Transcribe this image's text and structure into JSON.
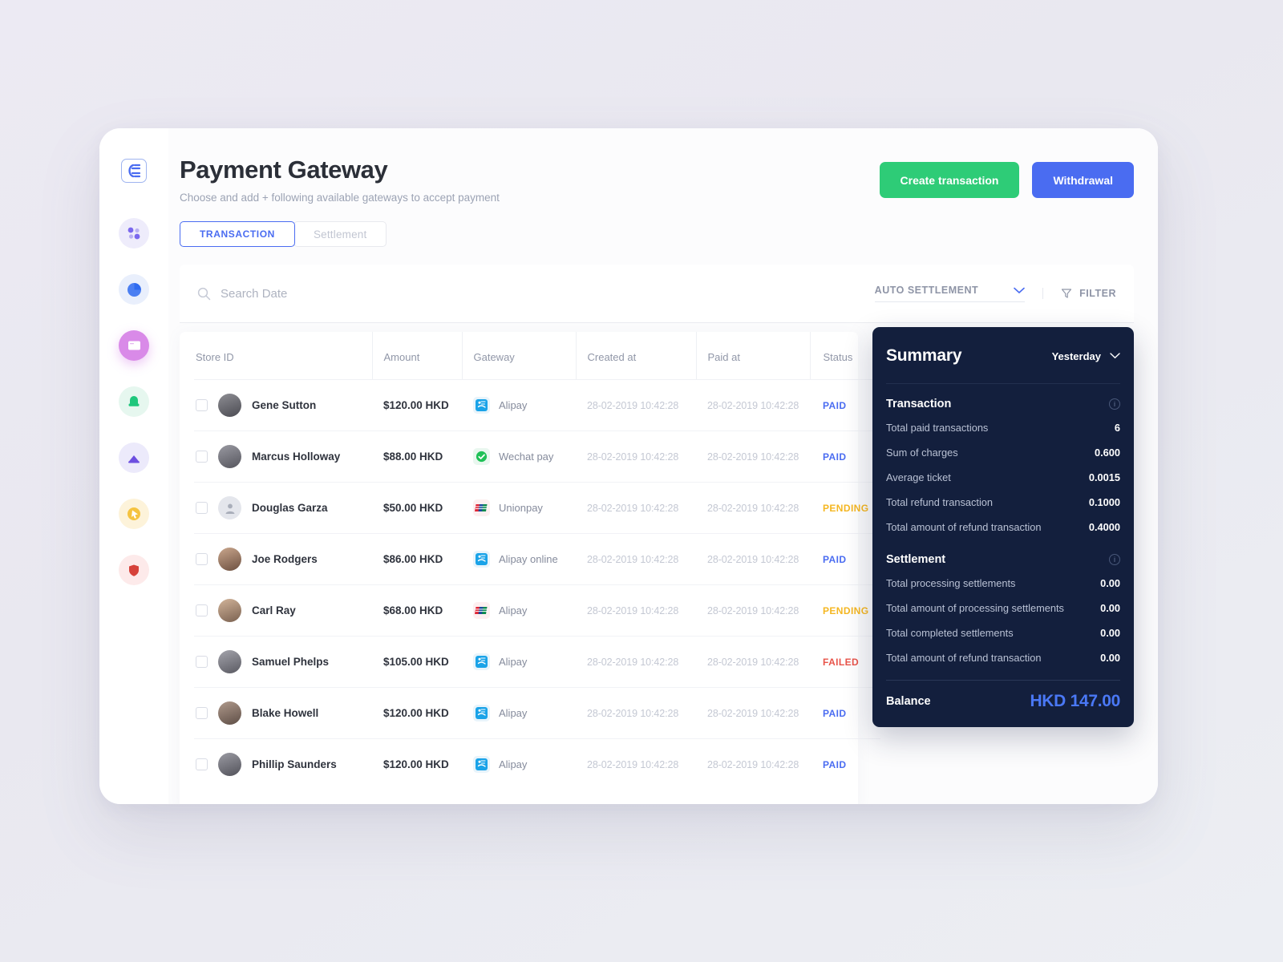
{
  "sidebar": {
    "logo_name": "logo-badge",
    "items": [
      {
        "name": "analytics-dots-icon",
        "color": "#7b68ee"
      },
      {
        "name": "pie-chart-icon",
        "color": "#2f6bf0"
      },
      {
        "name": "payments-card-icon",
        "color": "#ffffff"
      },
      {
        "name": "messages-icon",
        "color": "#1fc77c"
      },
      {
        "name": "media-upload-icon",
        "color": "#6d4fe0"
      },
      {
        "name": "cursor-click-icon",
        "color": "#f0ab1d"
      },
      {
        "name": "shield-icon",
        "color": "#d6413a"
      }
    ]
  },
  "header": {
    "title": "Payment Gateway",
    "subtitle": "Choose and add + following available gateways to accept payment",
    "create_label": "Create transaction",
    "withdrawal_label": "Withdrawal",
    "create_color": "#2ecc77",
    "withdrawal_color": "#4a6cf1"
  },
  "tabs": [
    {
      "label": "TRANSACTION",
      "active": true
    },
    {
      "label": "Settlement",
      "active": false
    }
  ],
  "search": {
    "placeholder": "Search Date",
    "value": "",
    "settlement_select": "AUTO SETTLEMENT",
    "filter_label": "FILTER"
  },
  "table": {
    "columns": [
      "Store ID",
      "Amount",
      "Gateway",
      "Created at",
      "Paid at",
      "Status"
    ],
    "rows": [
      {
        "name": "Gene Sutton",
        "amount": "$120.00 HKD",
        "gateway": "Alipay",
        "gateway_icon": "alipay-icon",
        "created_at": "28-02-2019 10:42:28",
        "paid_at": "28-02-2019 10:42:28",
        "status": "PAID"
      },
      {
        "name": "Marcus Holloway",
        "amount": "$88.00 HKD",
        "gateway": "Wechat pay",
        "gateway_icon": "wechat-icon",
        "created_at": "28-02-2019 10:42:28",
        "paid_at": "28-02-2019 10:42:28",
        "status": "PAID"
      },
      {
        "name": "Douglas Garza",
        "amount": "$50.00 HKD",
        "gateway": "Unionpay",
        "gateway_icon": "unionpay-icon",
        "created_at": "28-02-2019 10:42:28",
        "paid_at": "28-02-2019 10:42:28",
        "status": "PENDING"
      },
      {
        "name": "Joe Rodgers",
        "amount": "$86.00 HKD",
        "gateway": "Alipay online",
        "gateway_icon": "alipay-icon",
        "created_at": "28-02-2019 10:42:28",
        "paid_at": "28-02-2019 10:42:28",
        "status": "PAID"
      },
      {
        "name": "Carl Ray",
        "amount": "$68.00 HKD",
        "gateway": "Alipay",
        "gateway_icon": "unionpay-icon",
        "created_at": "28-02-2019 10:42:28",
        "paid_at": "28-02-2019 10:42:28",
        "status": "PENDING"
      },
      {
        "name": "Samuel Phelps",
        "amount": "$105.00 HKD",
        "gateway": "Alipay",
        "gateway_icon": "alipay-icon",
        "created_at": "28-02-2019 10:42:28",
        "paid_at": "28-02-2019 10:42:28",
        "status": "FAILED"
      },
      {
        "name": "Blake Howell",
        "amount": "$120.00 HKD",
        "gateway": "Alipay",
        "gateway_icon": "alipay-icon",
        "created_at": "28-02-2019 10:42:28",
        "paid_at": "28-02-2019 10:42:28",
        "status": "PAID"
      },
      {
        "name": "Phillip Saunders",
        "amount": "$120.00 HKD",
        "gateway": "Alipay",
        "gateway_icon": "alipay-icon",
        "created_at": "28-02-2019 10:42:28",
        "paid_at": "28-02-2019 10:42:28",
        "status": "PAID"
      }
    ]
  },
  "summary": {
    "title": "Summary",
    "period": "Yesterday",
    "transaction_section": "Transaction",
    "transaction_rows": [
      {
        "label": "Total paid transactions",
        "value": "6"
      },
      {
        "label": "Sum of charges",
        "value": "0.600"
      },
      {
        "label": "Average ticket",
        "value": "0.0015"
      },
      {
        "label": "Total refund transaction",
        "value": "0.1000"
      },
      {
        "label": "Total amount of refund transaction",
        "value": "0.4000"
      }
    ],
    "settlement_section": "Settlement",
    "settlement_rows": [
      {
        "label": "Total processing settlements",
        "value": "0.00"
      },
      {
        "label": "Total amount of processing settlements",
        "value": "0.00"
      },
      {
        "label": "Total completed settlements",
        "value": "0.00"
      },
      {
        "label": "Total amount of refund transaction",
        "value": "0.00"
      }
    ],
    "balance_label": "Balance",
    "balance_value": "HKD 147.00",
    "balance_color": "#4a78f5"
  },
  "status_colors": {
    "PAID": "#4a6cf1",
    "PENDING": "#f5b722",
    "FAILED": "#e8544a"
  }
}
